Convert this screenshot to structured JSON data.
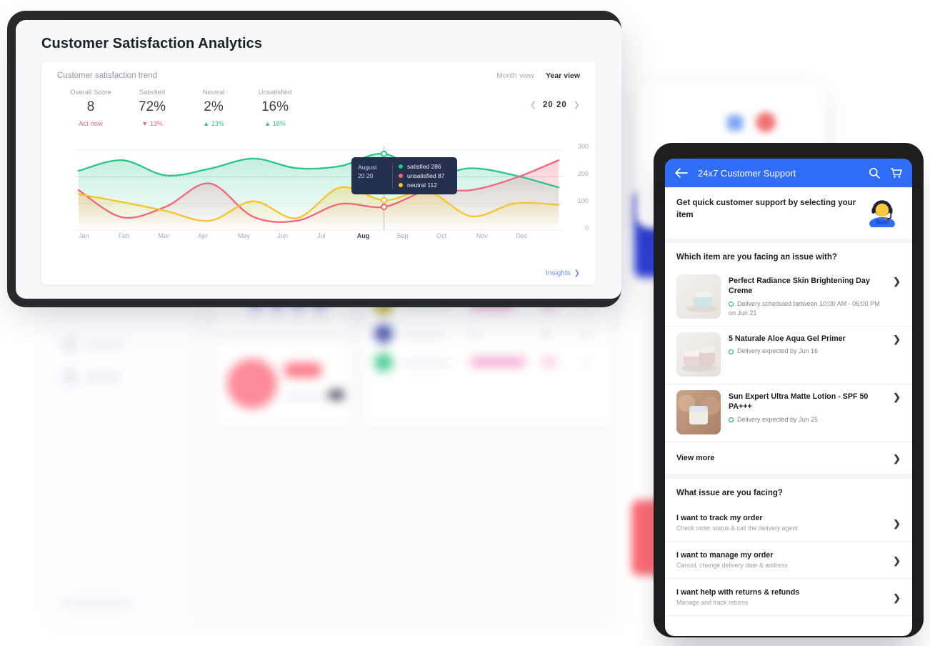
{
  "page": {
    "title": "Customer Satisfaction Analytics"
  },
  "chart_panel": {
    "title": "Customer satisfaction trend",
    "views": [
      {
        "label": "Month view",
        "active": false
      },
      {
        "label": "Year view",
        "active": true
      }
    ],
    "year": "20 20",
    "prev_icon": "chevron-left-icon",
    "next_icon": "chevron-right-icon",
    "insights_label": "Insights",
    "insights_icon": "chevron-right-icon",
    "stats": [
      {
        "label": "Overall Score",
        "value": "8",
        "delta": "Act now",
        "trend": "alert"
      },
      {
        "label": "Satisfied",
        "value": "72%",
        "delta": "13%",
        "trend": "down"
      },
      {
        "label": "Neutral",
        "value": "2%",
        "delta": "13%",
        "trend": "up"
      },
      {
        "label": "Unsatisfied",
        "value": "16%",
        "delta": "18%",
        "trend": "up"
      }
    ],
    "tooltip": {
      "month": "August",
      "year": "20 20",
      "rows": [
        {
          "label": "satisfied 286",
          "color": "#2bc48a"
        },
        {
          "label": "unsatisfied 87",
          "color": "#f2647b"
        },
        {
          "label": "neutral 112",
          "color": "#f5c32c"
        }
      ]
    }
  },
  "chart_data": {
    "type": "area",
    "title": "Customer satisfaction trend",
    "xlabel": "",
    "ylabel": "",
    "ylim": [
      0,
      300
    ],
    "yticks": [
      0,
      100,
      200,
      300
    ],
    "grid": true,
    "legend": "tooltip",
    "highlight_category": "Aug",
    "categories": [
      "Jan",
      "Feb",
      "Mar",
      "Apr",
      "May",
      "Jun",
      "Jul",
      "Aug",
      "Sep",
      "Oct",
      "Nov",
      "Dec"
    ],
    "series": [
      {
        "name": "satisfied",
        "color": "#2bc48a",
        "values": [
          222,
          262,
          205,
          230,
          268,
          232,
          240,
          286,
          205,
          232,
          205,
          160
        ]
      },
      {
        "name": "unsatisfied",
        "color": "#f2647b",
        "values": [
          150,
          48,
          88,
          175,
          50,
          35,
          98,
          87,
          148,
          150,
          195,
          262
        ]
      },
      {
        "name": "neutral",
        "color": "#f5c32c",
        "values": [
          135,
          105,
          72,
          35,
          108,
          45,
          160,
          112,
          145,
          52,
          100,
          95
        ]
      }
    ]
  },
  "mobile": {
    "header": {
      "back_icon": "back-arrow-icon",
      "title": "24x7 Customer Support",
      "search_icon": "search-icon",
      "cart_icon": "cart-icon"
    },
    "intro": {
      "text": "Get quick customer support by selecting your item",
      "icon": "support-agent-icon"
    },
    "item_section_title": "Which item are you facing an issue with?",
    "products": [
      {
        "name": "Perfect Radiance Skin Brightening Day Creme",
        "delivery": "Delivery scheduled between 10:00 AM - 06:00 PM on Jun 21",
        "status_icon": "green-circle-icon",
        "chevron": "chevron-right-icon"
      },
      {
        "name": "5 Naturale Aloe Aqua Gel Primer",
        "delivery": "Delivery expected by Jun 16",
        "status_icon": "green-circle-icon",
        "chevron": "chevron-right-icon"
      },
      {
        "name": "Sun Expert Ultra Matte Lotion - SPF 50 PA+++",
        "delivery": "Delivery expected by Jun 25",
        "status_icon": "green-circle-icon",
        "chevron": "chevron-right-icon"
      }
    ],
    "view_more": {
      "label": "View more",
      "chevron": "chevron-right-icon"
    },
    "issue_section_title": "What issue are you facing?",
    "issues": [
      {
        "title": "I want to track my order",
        "subtitle": "Check order status & call the delivery agent",
        "chevron": "chevron-right-icon"
      },
      {
        "title": "I want to manage my order",
        "subtitle": "Cancel, change delivery date & address",
        "chevron": "chevron-right-icon"
      },
      {
        "title": "I want help with returns & refunds",
        "subtitle": "Manage and track returns",
        "chevron": "chevron-right-icon"
      }
    ]
  },
  "colors": {
    "satisfied": "#2bc48a",
    "unsatisfied": "#f2647b",
    "neutral": "#f5c32c",
    "brand_blue": "#2f6df6",
    "link_blue": "#6a8ff0",
    "tooltip_bg": "#24304d"
  }
}
